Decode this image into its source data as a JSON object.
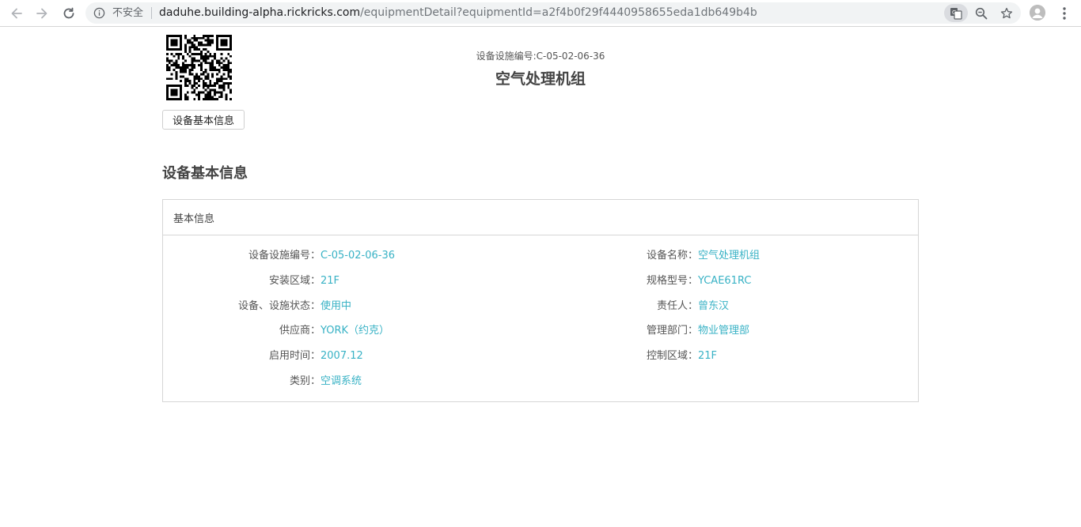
{
  "browser": {
    "security_label": "不安全",
    "url_host": "daduhe.building-alpha.rickricks.com",
    "url_path": "/equipmentDetail?equipmentId=a2f4b0f29f4440958655eda1db649b4b"
  },
  "header": {
    "code_line": "设备设施编号:C-05-02-06-36",
    "title": "空气处理机组",
    "tab_button": "设备基本信息"
  },
  "section": {
    "title": "设备基本信息",
    "card_header": "基本信息"
  },
  "fields": {
    "left": [
      {
        "label": "设备设施编号：",
        "value": "C-05-02-06-36"
      },
      {
        "label": "安装区域：",
        "value": "21F"
      },
      {
        "label": "设备、设施状态：",
        "value": "使用中"
      },
      {
        "label": "供应商：",
        "value": "YORK（约克）"
      },
      {
        "label": "启用时间：",
        "value": "2007.12"
      },
      {
        "label": "类别：",
        "value": "空调系统"
      }
    ],
    "right": [
      {
        "label": "设备名称：",
        "value": "空气处理机组"
      },
      {
        "label": "规格型号：",
        "value": "YCAE61RC"
      },
      {
        "label": "责任人：",
        "value": "曾东汉"
      },
      {
        "label": "管理部门：",
        "value": "物业管理部"
      },
      {
        "label": "控制区域：",
        "value": "21F"
      }
    ]
  },
  "colors": {
    "value_text": "#38b2c5",
    "label_text": "#555555",
    "border": "#d6d6d6"
  }
}
